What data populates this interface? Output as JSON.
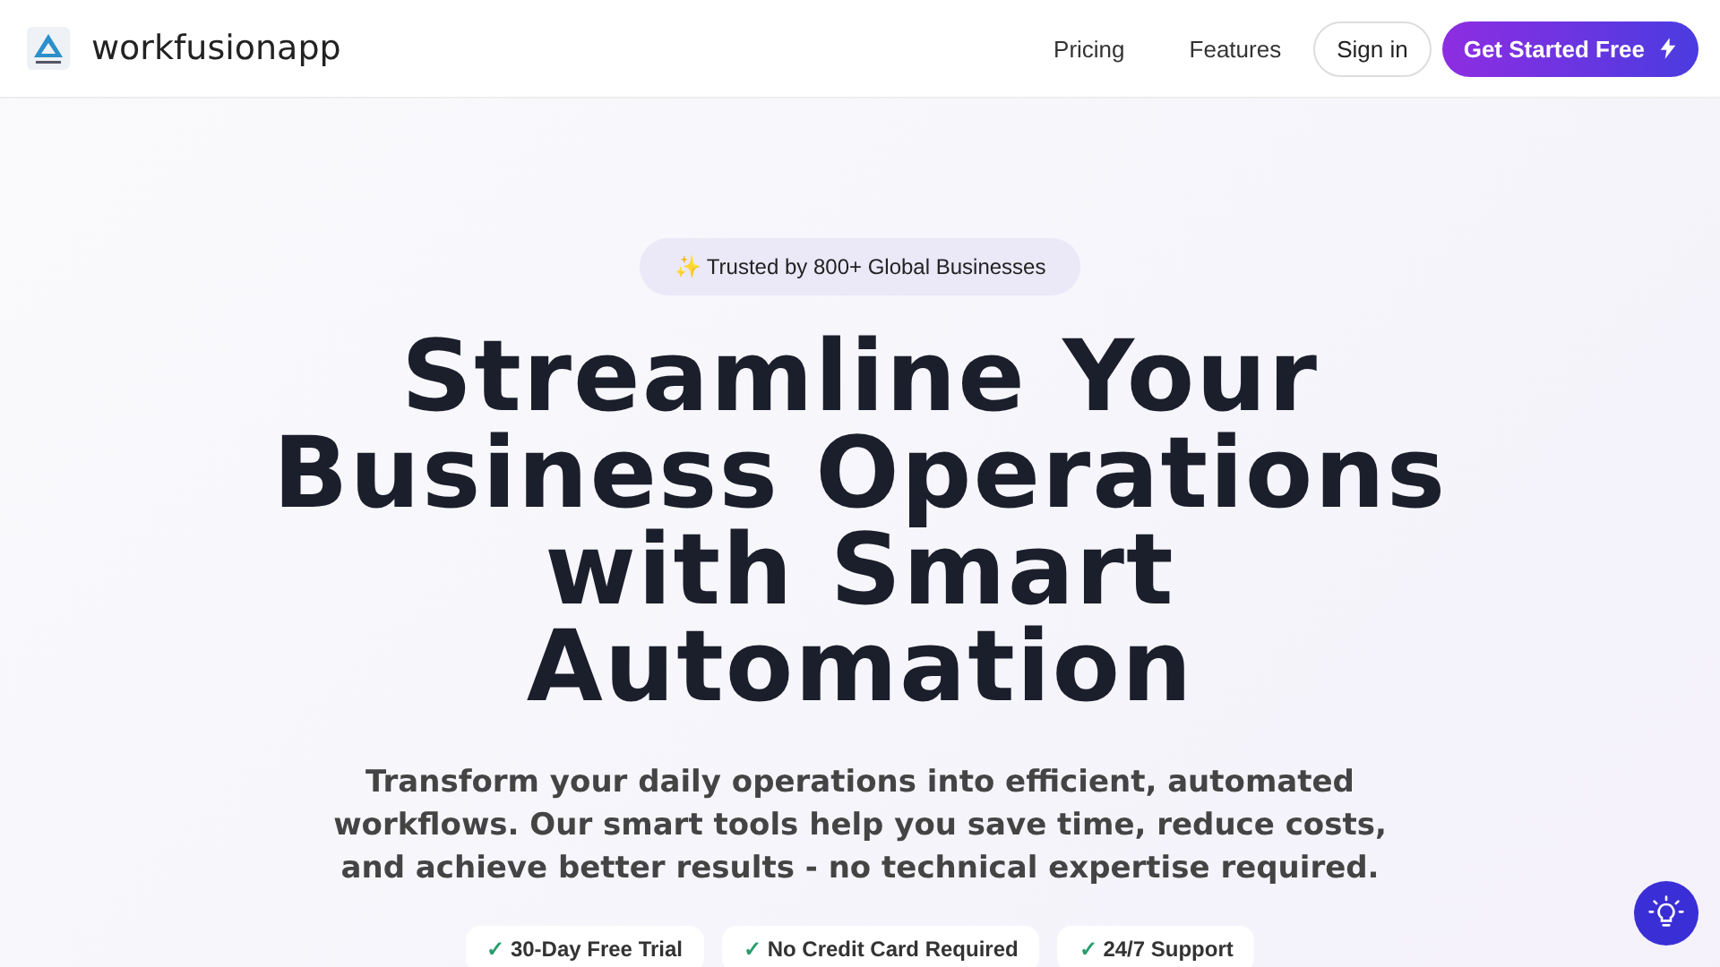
{
  "header": {
    "brand": "workfusionapp",
    "nav": [
      {
        "label": "Pricing"
      },
      {
        "label": "Features"
      }
    ],
    "sign_in": "Sign in",
    "cta": "Get Started Free"
  },
  "hero": {
    "badge": {
      "icon": "✨",
      "text": "Trusted by 800+ Global Businesses"
    },
    "title": "Streamline Your Business Operations with Smart Automation",
    "subtitle": "Transform your daily operations into efficient, automated workflows. Our smart tools help you save time, reduce costs, and achieve better results - no technical expertise required.",
    "features": [
      {
        "check": "✓",
        "text": "30-Day Free Trial"
      },
      {
        "check": "✓",
        "text": "No Credit Card Required"
      },
      {
        "check": "✓",
        "text": "24/7 Support"
      }
    ]
  }
}
